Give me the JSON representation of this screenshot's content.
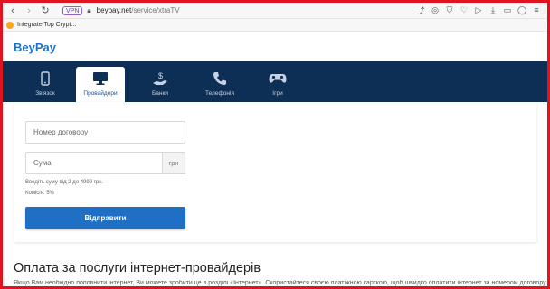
{
  "browser": {
    "vpn_badge": "VPN",
    "url_domain": "beypay.net",
    "url_path": "/service/xtraTV",
    "bookmark_label": "Integrate Top Crypt..."
  },
  "site": {
    "logo": "BeyPay"
  },
  "nav": {
    "items": [
      {
        "label": "Зв'язок",
        "icon": "phone-icon"
      },
      {
        "label": "Провайдери",
        "icon": "monitor-icon",
        "active": true
      },
      {
        "label": "Банки",
        "icon": "money-hand-icon"
      },
      {
        "label": "Телефонія",
        "icon": "handset-icon"
      },
      {
        "label": "Ігри",
        "icon": "gamepad-icon"
      }
    ]
  },
  "form": {
    "contract_placeholder": "Номер договору",
    "amount_placeholder": "Сума",
    "currency": "грн",
    "hint_range": "Введіть суму від 2 до 4999 грн.",
    "hint_fee": "Комісія: 5%",
    "submit_label": "Відправити"
  },
  "section": {
    "title": "Оплата за послуги інтернет-провайдерів",
    "text": "Якщо Вам необхідно поповнити інтернет, Ви можете зробити це в розділі «Інтернет». Скористайтеся своєю платіжною карткою, щоб швидко оплатити інтернет за номером договору або"
  },
  "colors": {
    "nav_bg": "#0e2f55",
    "brand": "#1e72c8",
    "button": "#1f6fc5",
    "frame": "#e0141e"
  }
}
